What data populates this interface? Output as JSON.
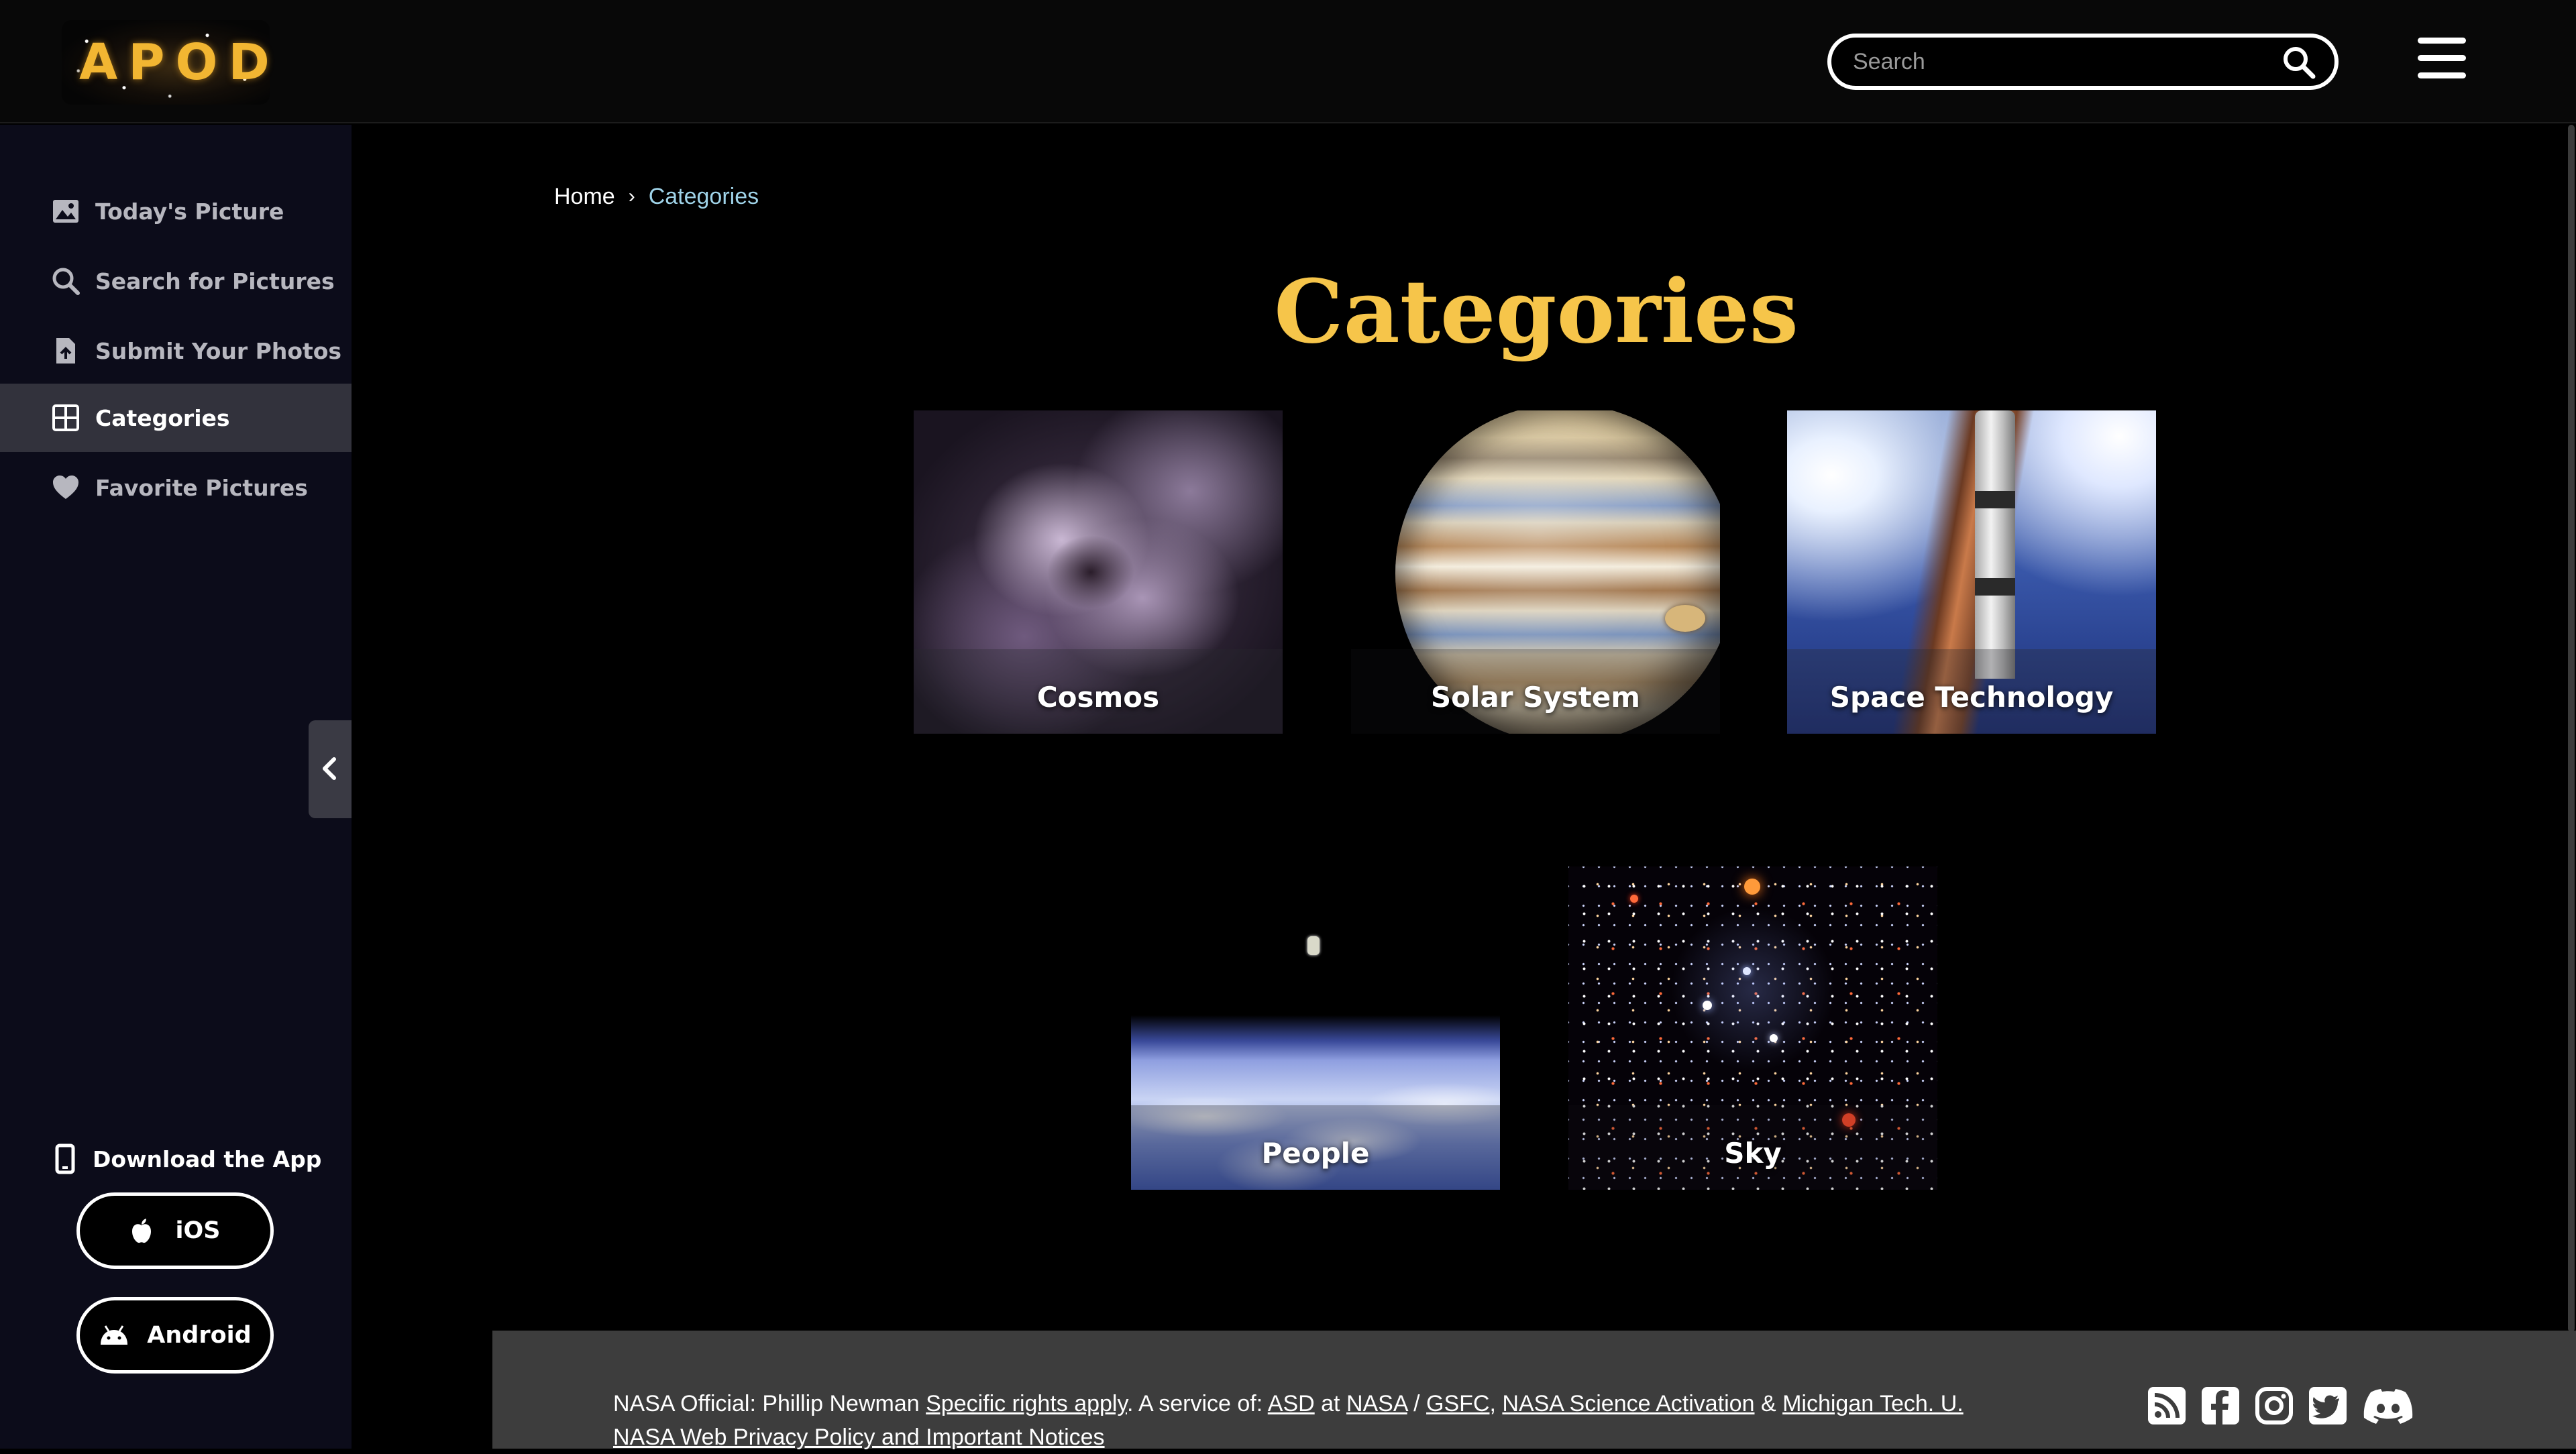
{
  "header": {
    "logo_text": "APOD",
    "search_placeholder": "Search",
    "search_value": ""
  },
  "sidebar": {
    "items": [
      {
        "label": "Today's Picture",
        "icon": "image-icon"
      },
      {
        "label": "Search for Pictures",
        "icon": "search-icon"
      },
      {
        "label": "Submit Your Photos",
        "icon": "upload-file-icon"
      },
      {
        "label": "Categories",
        "icon": "grid-icon",
        "active": true
      },
      {
        "label": "Favorite Pictures",
        "icon": "heart-icon"
      }
    ],
    "download_label": "Download the App",
    "ios_label": "iOS",
    "android_label": "Android"
  },
  "breadcrumb": {
    "home": "Home",
    "separator": "›",
    "current": "Categories"
  },
  "page": {
    "title": "Categories",
    "title_color": "#f6c54a"
  },
  "categories": [
    {
      "label": "Cosmos"
    },
    {
      "label": "Solar System"
    },
    {
      "label": "Space Technology"
    },
    {
      "label": "People"
    },
    {
      "label": "Sky"
    }
  ],
  "footer": {
    "official_prefix": "NASA Official: Phillip Newman",
    "rights_link": "Specific rights apply",
    "service_prefix": ". A service of:",
    "asd": "ASD",
    "at": "at",
    "nasa": "NASA",
    "slash": "/",
    "gsfc": "GSFC",
    "comma": ",",
    "science": "NASA Science Activation",
    "amp": "&",
    "mtu": "Michigan Tech. U.",
    "privacy": "NASA Web Privacy Policy and Important Notices",
    "social": [
      "rss-icon",
      "facebook-icon",
      "instagram-icon",
      "twitter-icon",
      "discord-icon"
    ]
  }
}
